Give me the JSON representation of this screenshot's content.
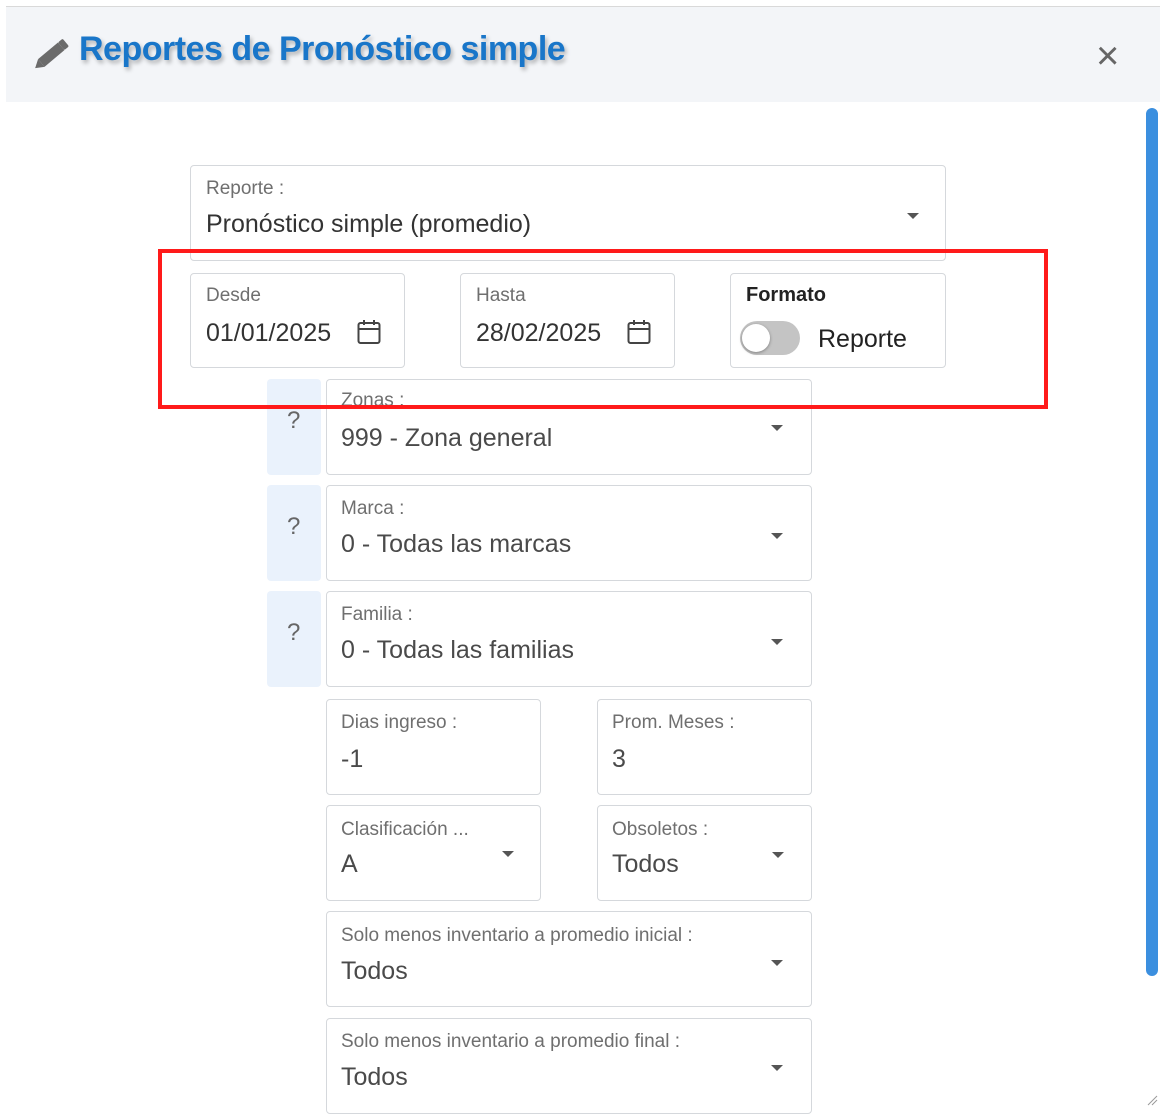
{
  "dialog": {
    "title": "Reportes de Pronóstico simple",
    "close_symbol": "×",
    "accent_color": "#1976c9"
  },
  "form": {
    "reporte": {
      "label": "Reporte :",
      "value": "Pronóstico simple (promedio)"
    },
    "desde": {
      "label": "Desde",
      "value": "01/01/2025"
    },
    "hasta": {
      "label": "Hasta",
      "value": "28/02/2025"
    },
    "formato": {
      "label": "Formato",
      "toggle_label": "Reporte",
      "toggle_on": false
    },
    "zonas": {
      "label": "Zonas :",
      "value": "999 - Zona general",
      "help": "?"
    },
    "marca": {
      "label": "Marca :",
      "value": "0 - Todas las marcas",
      "help": "?"
    },
    "familia": {
      "label": "Familia :",
      "value": "0 - Todas las familias",
      "help": "?"
    },
    "dias_ingreso": {
      "label": "Dias ingreso :",
      "value": "-1"
    },
    "prom_meses": {
      "label": "Prom. Meses :",
      "value": "3"
    },
    "clasificacion": {
      "label": "Clasificación ...",
      "value": "A"
    },
    "obsoletos": {
      "label": "Obsoletos :",
      "value": "Todos"
    },
    "solo_menos_inicial": {
      "label": "Solo menos inventario a promedio inicial :",
      "value": "Todos"
    },
    "solo_menos_final": {
      "label": "Solo menos inventario a promedio final :",
      "value": "Todos"
    }
  },
  "icons": {
    "title": "pencil-icon",
    "calendar": "calendar-icon",
    "dropdown": "caret-down-icon",
    "close": "close-icon"
  },
  "highlight_color": "#ff1a1a"
}
